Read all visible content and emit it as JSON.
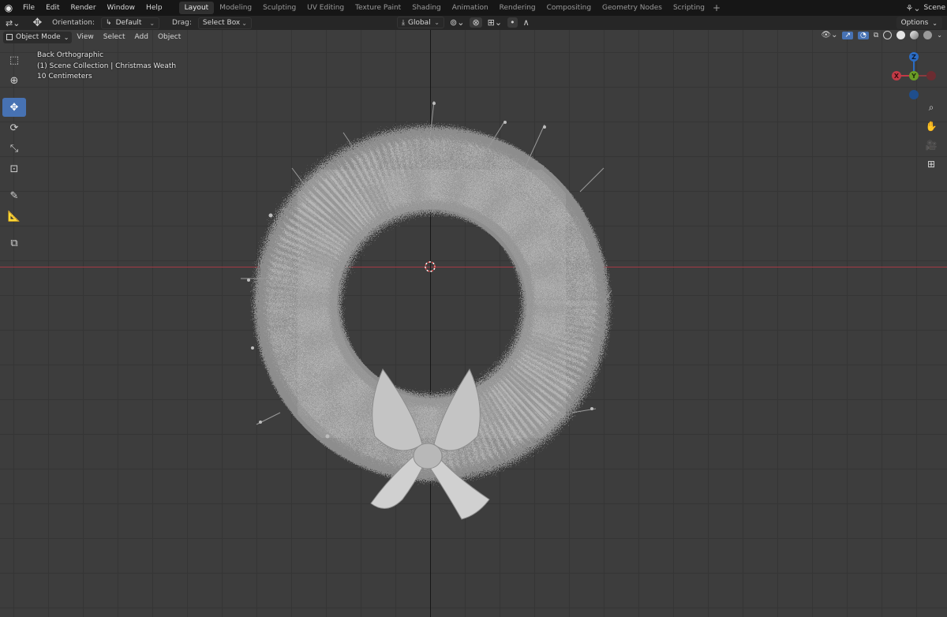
{
  "menubar": {
    "items": [
      "File",
      "Edit",
      "Render",
      "Window",
      "Help"
    ],
    "workspaces": [
      "Layout",
      "Modeling",
      "Sculpting",
      "UV Editing",
      "Texture Paint",
      "Shading",
      "Animation",
      "Rendering",
      "Compositing",
      "Geometry Nodes",
      "Scripting"
    ],
    "active_workspace": "Layout",
    "add_tab": "+",
    "scene": "Scene"
  },
  "toolheader": {
    "orientation_label": "Orientation:",
    "orientation_value": "Default",
    "drag_label": "Drag:",
    "drag_value": "Select Box",
    "transform_space": "Global",
    "options_label": "Options"
  },
  "viewport_header": {
    "mode": "Object Mode",
    "menus": [
      "View",
      "Select",
      "Add",
      "Object"
    ]
  },
  "viewport_info": {
    "view_name": "Back Orthographic",
    "collection": "(1) Scene Collection | Christmas Weath",
    "scale": "10 Centimeters"
  },
  "gizmo": {
    "z": "Z",
    "y": "Y",
    "x_label": "X"
  },
  "colors": {
    "accent": "#4772b3",
    "x_axis": "#c23a46",
    "y_axis": "#6a9c26",
    "z_axis": "#2b6cc4",
    "grid_bg": "#3d3d3d"
  }
}
